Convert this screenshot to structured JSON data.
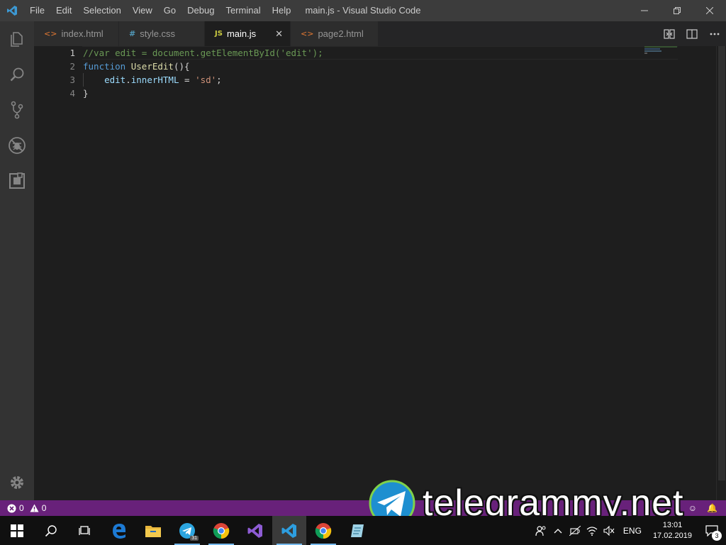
{
  "window": {
    "title": "main.js - Visual Studio Code",
    "menu": [
      "File",
      "Edit",
      "Selection",
      "View",
      "Go",
      "Debug",
      "Terminal",
      "Help"
    ]
  },
  "activity_bar": {
    "icons": [
      "explorer-icon",
      "search-icon",
      "source-control-icon",
      "debug-icon",
      "extensions-icon"
    ],
    "bottom_icon": "gear-icon"
  },
  "tabs": [
    {
      "label": "index.html",
      "icon": "<>",
      "icon_color": "#e37933",
      "active": false
    },
    {
      "label": "style.css",
      "icon": "#",
      "icon_color": "#519aba",
      "active": false
    },
    {
      "label": "main.js",
      "icon": "JS",
      "icon_color": "#cbcb41",
      "active": true,
      "close": "✕"
    },
    {
      "label": "page2.html",
      "icon": "<>",
      "icon_color": "#e37933",
      "active": false
    }
  ],
  "editor": {
    "line_numbers": [
      "1",
      "2",
      "3",
      "4"
    ],
    "lines": [
      "//var edit = document.getElementById('edit');",
      "function UserEdit(){",
      "    edit.innerHTML = 'sd';",
      "}"
    ]
  },
  "statusbar": {
    "errors": "0",
    "warnings": "0",
    "bg_color": "#68217a"
  },
  "watermark": {
    "text": "telegrammy.net"
  },
  "taskbar": {
    "apps": [
      "windows-start-icon",
      "search-icon",
      "task-view-icon",
      "edge-icon",
      "file-explorer-icon",
      "telegram-icon",
      "chrome-icon",
      "visual-studio-icon",
      "vscode-icon",
      "chrome-icon",
      "notes-icon"
    ],
    "telegram_badge": "31",
    "language": "ENG",
    "time": "13:01",
    "date": "17.02.2019",
    "notifications": "3"
  }
}
